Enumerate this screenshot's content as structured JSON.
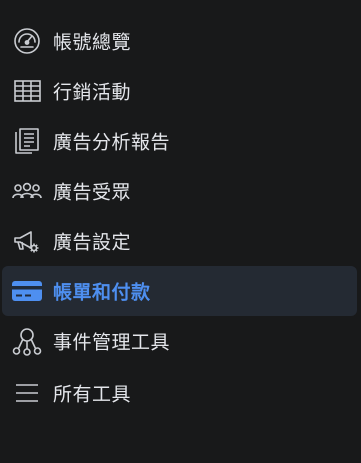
{
  "accent_color": "#4e8ff0",
  "sidebar": {
    "items": [
      {
        "label": "帳號總覽",
        "icon": "dashboard-gauge-icon"
      },
      {
        "label": "行銷活動",
        "icon": "table-grid-icon"
      },
      {
        "label": "廣告分析報告",
        "icon": "report-pages-icon"
      },
      {
        "label": "廣告受眾",
        "icon": "audience-people-icon"
      },
      {
        "label": "廣告設定",
        "icon": "megaphone-gear-icon"
      },
      {
        "label": "帳單和付款",
        "icon": "credit-card-icon",
        "active": true
      },
      {
        "label": "事件管理工具",
        "icon": "event-network-icon"
      },
      {
        "label": "所有工具",
        "icon": "hamburger-menu-icon"
      }
    ]
  }
}
